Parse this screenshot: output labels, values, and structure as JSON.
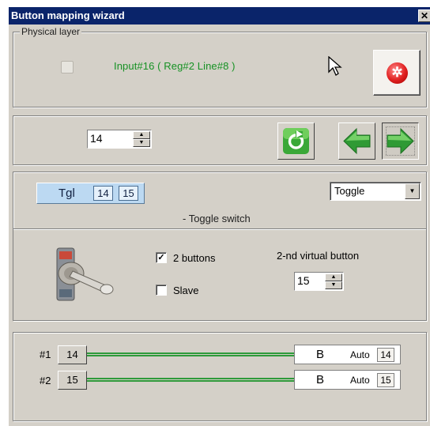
{
  "window": {
    "title": "Button mapping wizard",
    "close_glyph": "✕"
  },
  "physical": {
    "group_label": "Physical layer",
    "input_info": "Input#16 ( Reg#2  Line#8 )",
    "record_icon": "record-icon"
  },
  "navigator": {
    "button_value": "14",
    "buttons": [
      "reset-icon",
      "back-arrow-icon",
      "forward-arrow-icon"
    ]
  },
  "toggle": {
    "mode_label": "Tgl",
    "chips": [
      "14",
      "15"
    ],
    "dropdown_value": "Toggle",
    "description": "- Toggle switch"
  },
  "options": {
    "two_buttons_label": "2 buttons",
    "two_buttons_checked": "✓",
    "slave_label": "Slave",
    "second_vb_label": "2-nd virtual button",
    "second_vb_value": "15"
  },
  "mapping": {
    "rows": [
      {
        "label": "#1",
        "button": "14",
        "key": "B",
        "auto_label": "Auto",
        "auto_value": "14"
      },
      {
        "label": "#2",
        "button": "15",
        "key": "B",
        "auto_label": "Auto",
        "auto_value": "15"
      }
    ]
  },
  "colors": {
    "title_bar": "#0a246a",
    "accent_green": "#2e9a3a",
    "record_red": "#e02020",
    "chip_blue": "#bcd9f2"
  }
}
